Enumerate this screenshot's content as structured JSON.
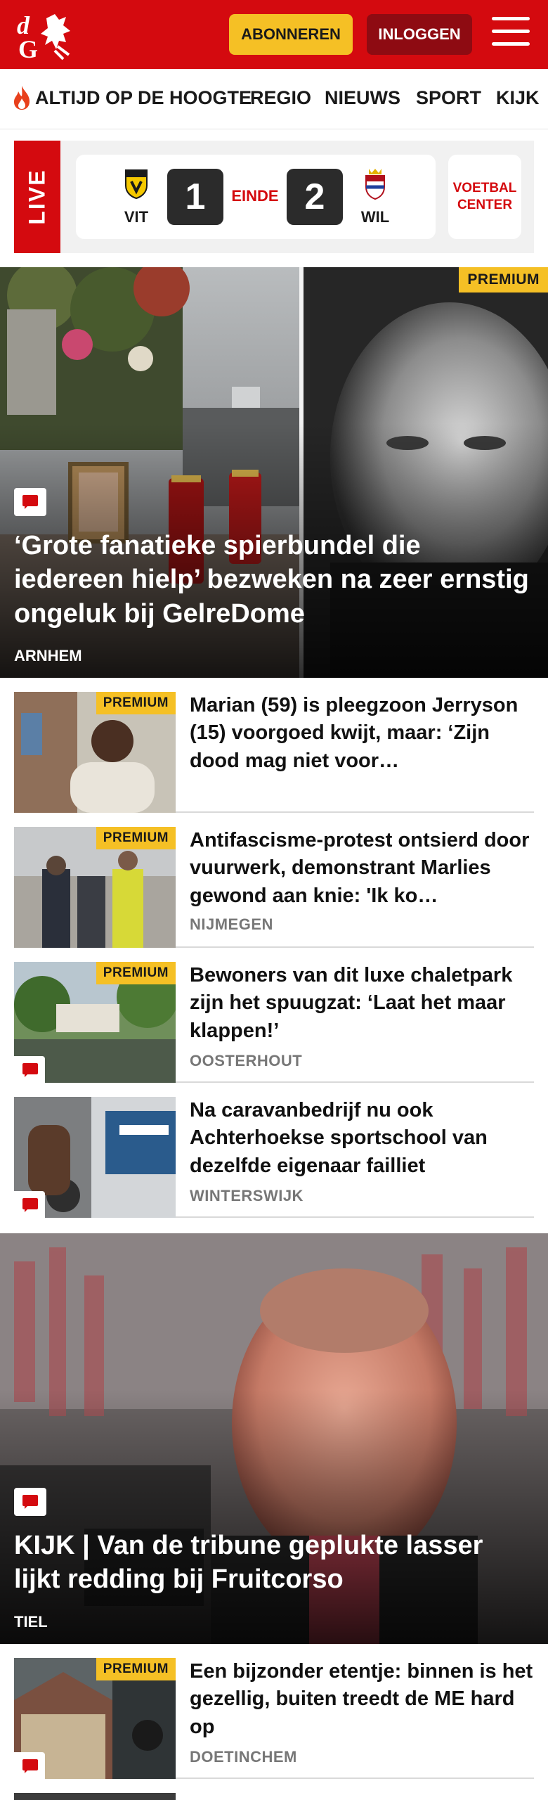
{
  "header": {
    "subscribe_label": "ABONNEREN",
    "login_label": "INLOGGEN",
    "brand_color": "#d40a0f",
    "accent_color": "#f5c025"
  },
  "nav": {
    "items": [
      "ALTIJD OP DE HOOGTE",
      "REGIO",
      "NIEUWS",
      "SPORT",
      "KIJK"
    ]
  },
  "live": {
    "tag": "LIVE",
    "home_team": "VIT",
    "away_team": "WIL",
    "home_score": "1",
    "away_score": "2",
    "status": "EINDE",
    "voetbal_center": "VOETBAL CENTER"
  },
  "articles": [
    {
      "title": "‘Grote fanatieke spierbundel die iedereen hielp’ bezweken na zeer ernstig ongeluk bij GelreDome",
      "location": "ARNHEM",
      "premium": "PREMIUM"
    },
    {
      "title": "Marian (59) is pleegzoon Jerryson (15) voorgoed kwijt, maar: ‘Zijn dood mag niet voor…",
      "location": "",
      "premium": "PREMIUM"
    },
    {
      "title": "Antifascisme-protest ontsierd door vuurwerk, demonstrant Marlies gewond aan knie: 'Ik ko…",
      "location": "NIJMEGEN",
      "premium": "PREMIUM"
    },
    {
      "title": "Bewoners van dit luxe chaletpark zijn het spuugzat: ‘Laat het maar klappen!’",
      "location": "OOSTERHOUT",
      "premium": "PREMIUM"
    },
    {
      "title": "Na caravanbedrijf nu ook Achterhoekse sportschool van dezelfde eigenaar failliet",
      "location": "WINTERSWIJK"
    },
    {
      "title": "KIJK | Van de tribune geplukte lasser lijkt redding bij Fruitcorso",
      "location": "TIEL"
    },
    {
      "title": "Een bijzonder etentje: binnen is het gezellig, buiten treedt de ME hard op",
      "location": "DOETINCHEM",
      "premium": "PREMIUM"
    }
  ]
}
